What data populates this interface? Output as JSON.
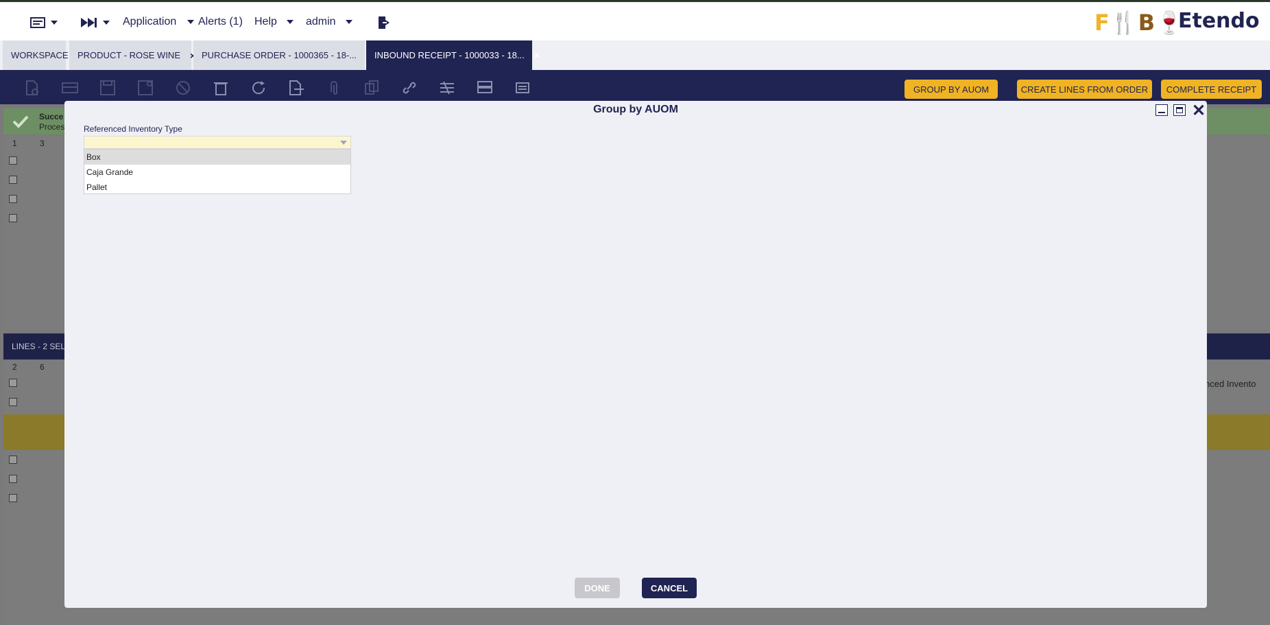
{
  "nav": {
    "application": "Application",
    "alerts": "Alerts (1)",
    "help": "Help",
    "user": "admin",
    "logo_fb": "F",
    "logo_fb_mid": "B",
    "logo_etendo": "Etendo"
  },
  "tabs": [
    {
      "label": "WORKSPACE"
    },
    {
      "label": "PRODUCT - ROSE WINE"
    },
    {
      "label": "PURCHASE ORDER - 1000365 - 18-..."
    },
    {
      "label": "INBOUND RECEIPT - 1000033 - 18..."
    }
  ],
  "tab_close_glyph": "×",
  "toolbar": {
    "group_by_auom": "GROUP BY AUOM",
    "create_lines": "CREATE LINES FROM ORDER",
    "complete_receipt": "COMPLETE RECEIPT"
  },
  "background": {
    "success_title": "Succe",
    "success_sub": "Proces",
    "header_col1": "1",
    "header_col2": "3",
    "lines_header": "LINES - 2 SELE",
    "lines_col1": "2",
    "lines_col2": "6",
    "lines_right_col": "nced Invento"
  },
  "modal": {
    "title": "Group by AUOM",
    "field_label": "Referenced Inventory Type",
    "combo_value": "",
    "options": [
      "Box",
      "Caja Grande",
      "Pallet"
    ],
    "done": "DONE",
    "cancel": "CANCEL",
    "close_glyph": "✕"
  },
  "colors": {
    "navy": "#202452",
    "accent": "#f0b323"
  }
}
